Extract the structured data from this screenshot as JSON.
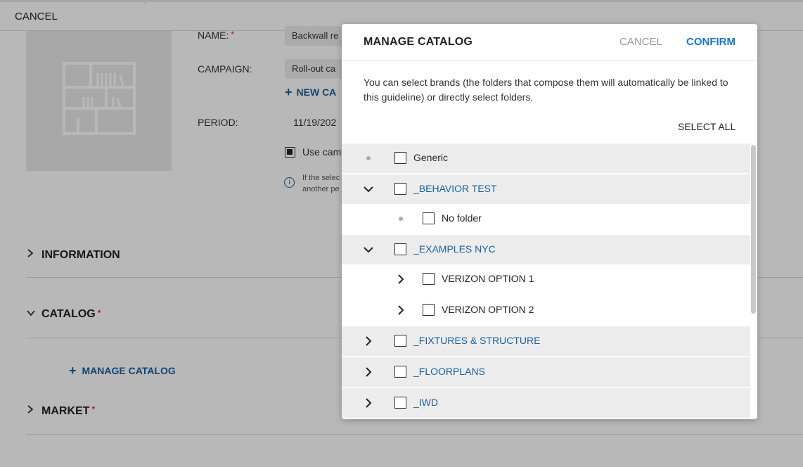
{
  "topbar": {
    "cancel_label": "CANCEL"
  },
  "form": {
    "name_label": "NAME:",
    "name_value": "Backwall re",
    "campaign_label": "CAMPAIGN:",
    "campaign_value": "Roll-out ca",
    "new_campaign_label": "NEW CA",
    "period_label": "PERIOD:",
    "period_value": "11/19/202",
    "use_campaign_label": "Use cam",
    "info_line1": "If the selec",
    "info_line2": "another pe",
    "required_mark": "*"
  },
  "sections": {
    "information": "INFORMATION",
    "catalog": "CATALOG",
    "market": "MARKET",
    "manage_catalog_link": "MANAGE CATALOG"
  },
  "modal": {
    "title": "MANAGE CATALOG",
    "cancel_label": "CANCEL",
    "confirm_label": "CONFIRM",
    "description": "You can select brands (the folders that compose them will automatically be linked to this guideline) or directly select folders.",
    "select_all_label": "SELECT ALL",
    "items": [
      {
        "label": "Generic",
        "marker": "dot",
        "level": 0,
        "type": "brand",
        "checked": false
      },
      {
        "label": "_BEHAVIOR TEST",
        "marker": "chevron-down",
        "level": 0,
        "type": "brand",
        "checked": false
      },
      {
        "label": "No folder",
        "marker": "dot",
        "level": 1,
        "type": "folder",
        "checked": false
      },
      {
        "label": "_EXAMPLES NYC",
        "marker": "chevron-down",
        "level": 0,
        "type": "brand",
        "checked": false
      },
      {
        "label": "VERIZON OPTION 1",
        "marker": "chevron-right",
        "level": 1,
        "type": "folder",
        "checked": false
      },
      {
        "label": "VERIZON OPTION 2",
        "marker": "chevron-right",
        "level": 1,
        "type": "folder",
        "checked": false
      },
      {
        "label": "_FIXTURES & STRUCTURE",
        "marker": "chevron-right",
        "level": 0,
        "type": "brand",
        "checked": false
      },
      {
        "label": "_FLOORPLANS",
        "marker": "chevron-right",
        "level": 0,
        "type": "brand",
        "checked": false
      },
      {
        "label": "_IWD",
        "marker": "chevron-right",
        "level": 0,
        "type": "brand",
        "checked": false
      }
    ]
  },
  "colors": {
    "link_blue": "#1a5f9e",
    "confirm_blue": "#1a73c8",
    "required_red": "#d33333",
    "row_shade": "#ececec"
  }
}
